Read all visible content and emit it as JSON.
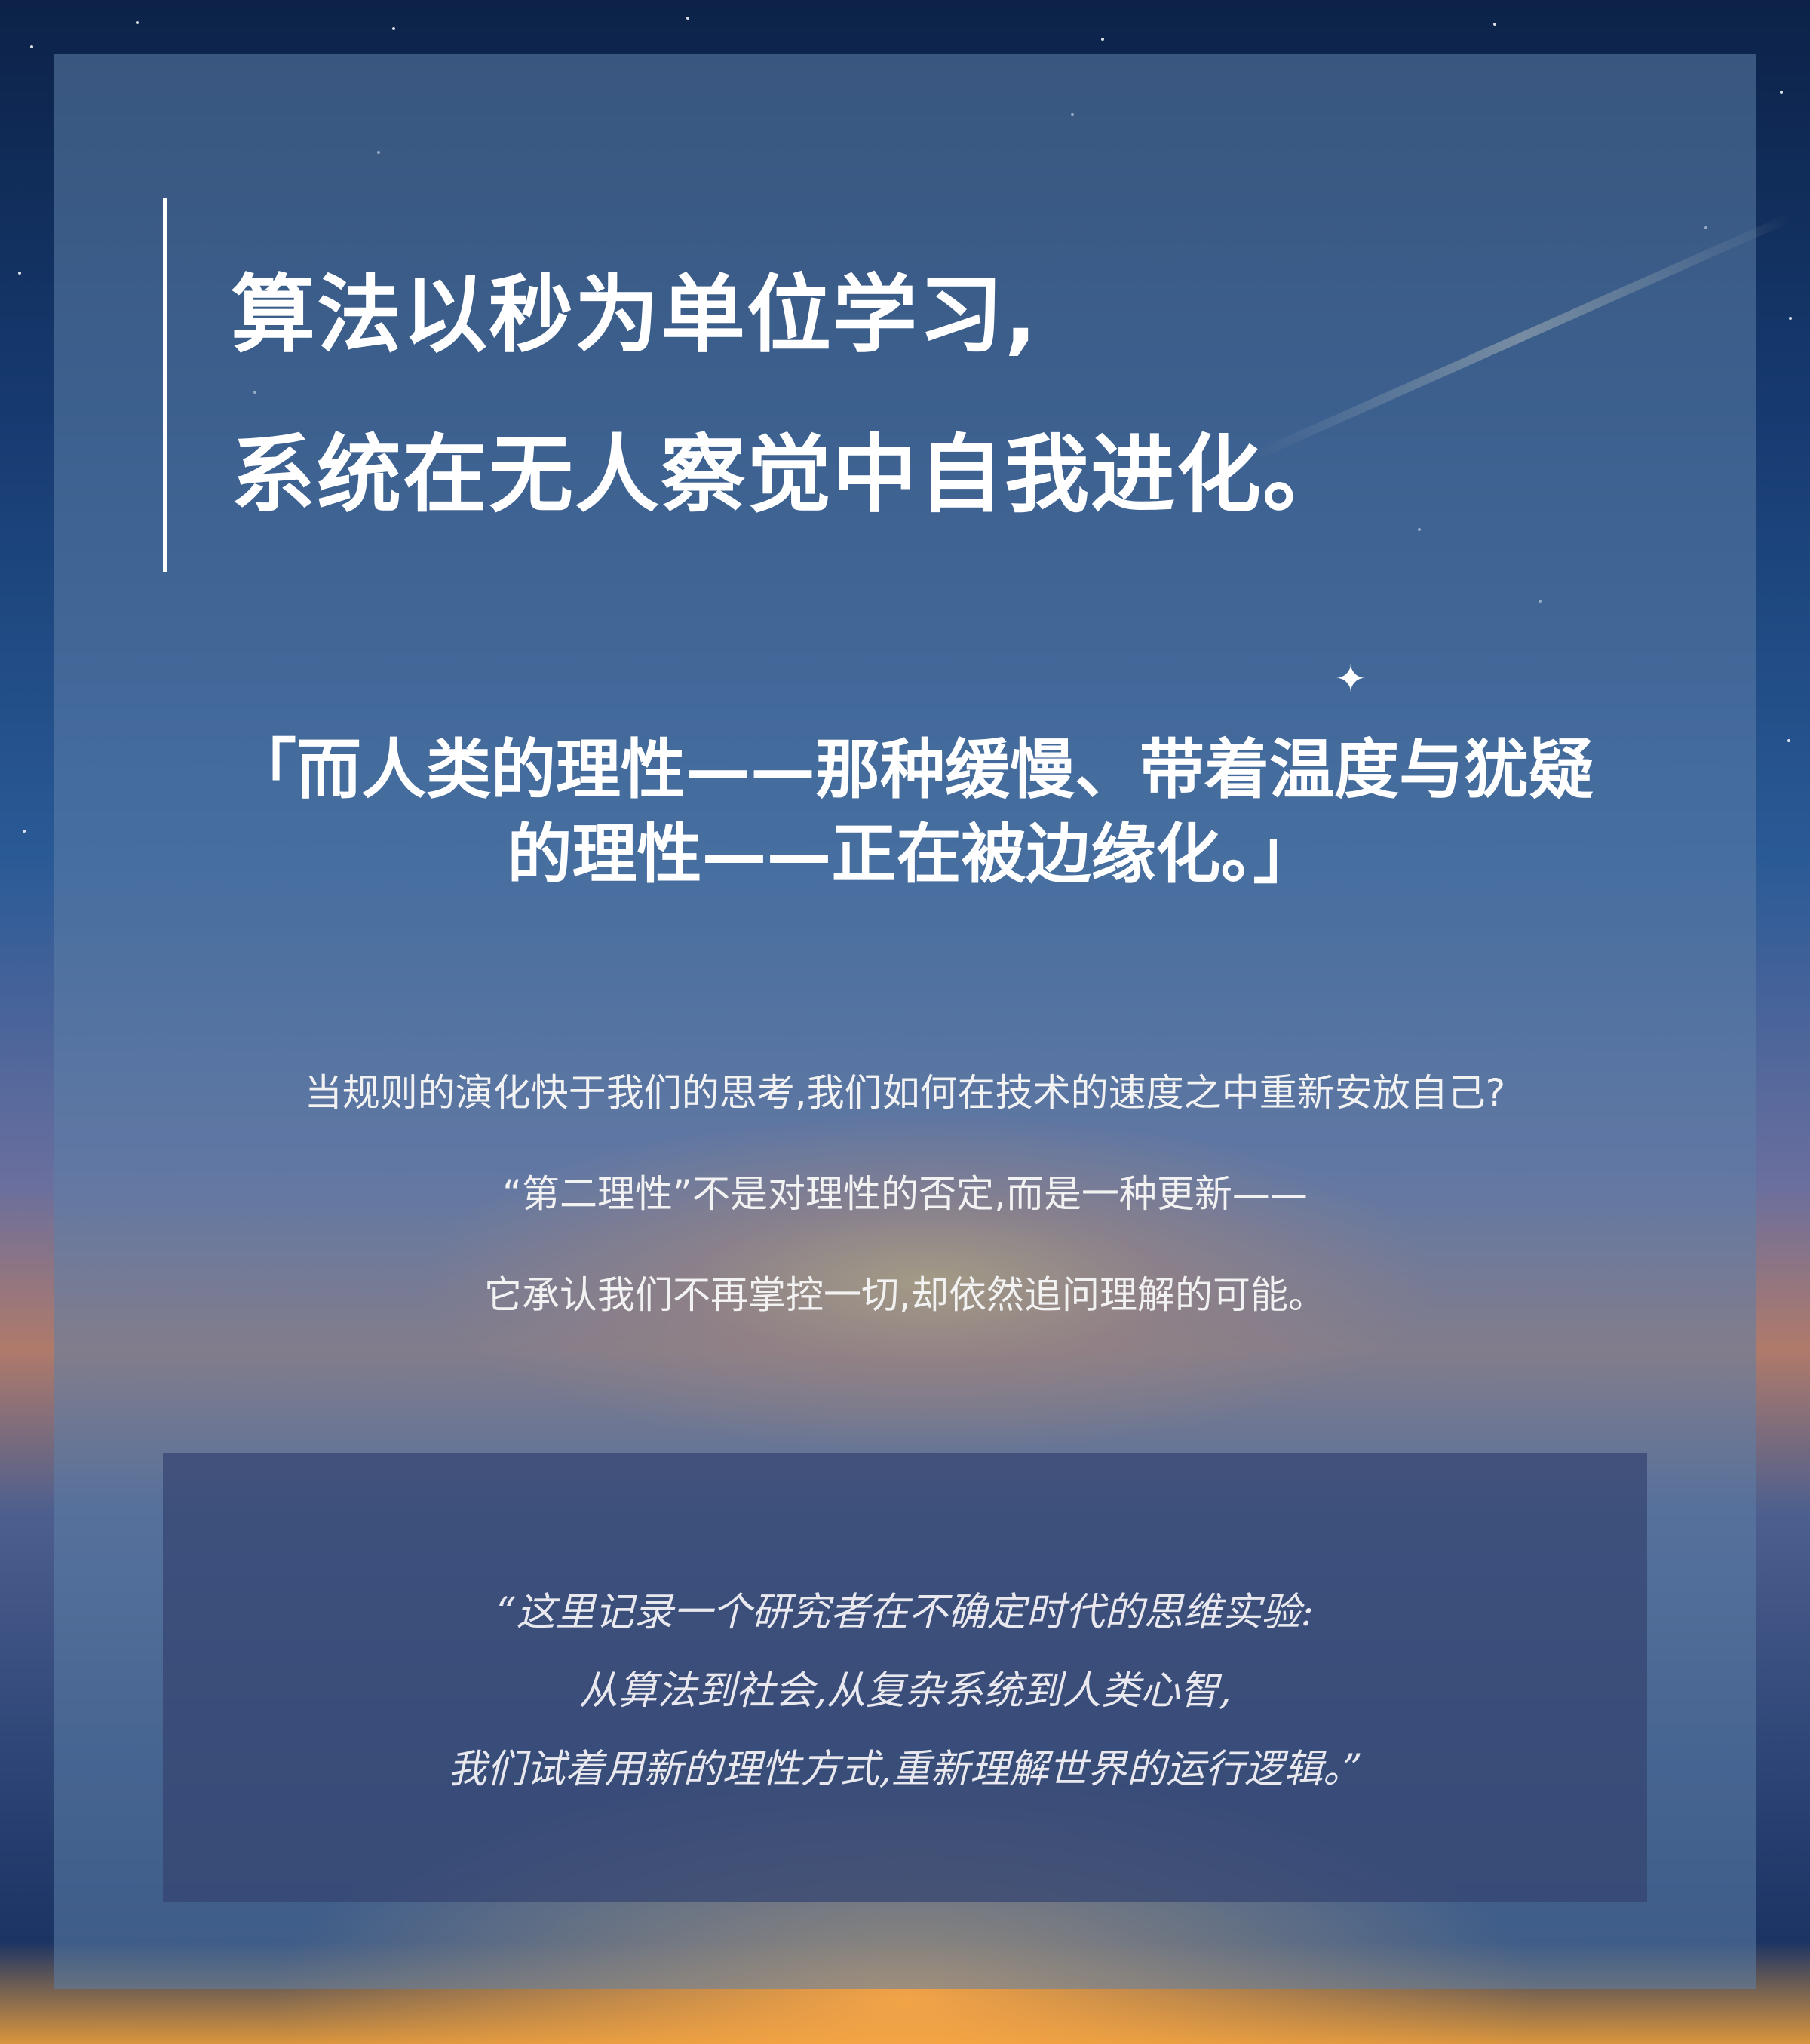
{
  "headline": {
    "line1": "算法以秒为单位学习,",
    "line2": "系统在无人察觉中自我进化。"
  },
  "subhead": {
    "line1": "「而人类的理性——那种缓慢、带着温度与犹疑",
    "line2": "的理性——正在被边缘化。」"
  },
  "body": {
    "line1": "当规则的演化快于我们的思考,我们如何在技术的速度之中重新安放自己?",
    "line2": "“第二理性”不是对理性的否定,而是一种更新——",
    "line3": "它承认我们不再掌控一切,却依然追问理解的可能。"
  },
  "quote": {
    "line1": "“这里记录一个研究者在不确定时代的思维实验:",
    "line2": "从算法到社会,从复杂系统到人类心智,",
    "line3": "我们试着用新的理性方式,重新理解世界的运行逻辑。”"
  },
  "icons": {
    "sparkle": "sparkle-star-icon"
  },
  "colors": {
    "panel": "#5c80a8",
    "quote_box": "#344470",
    "text": "#ffffff"
  }
}
